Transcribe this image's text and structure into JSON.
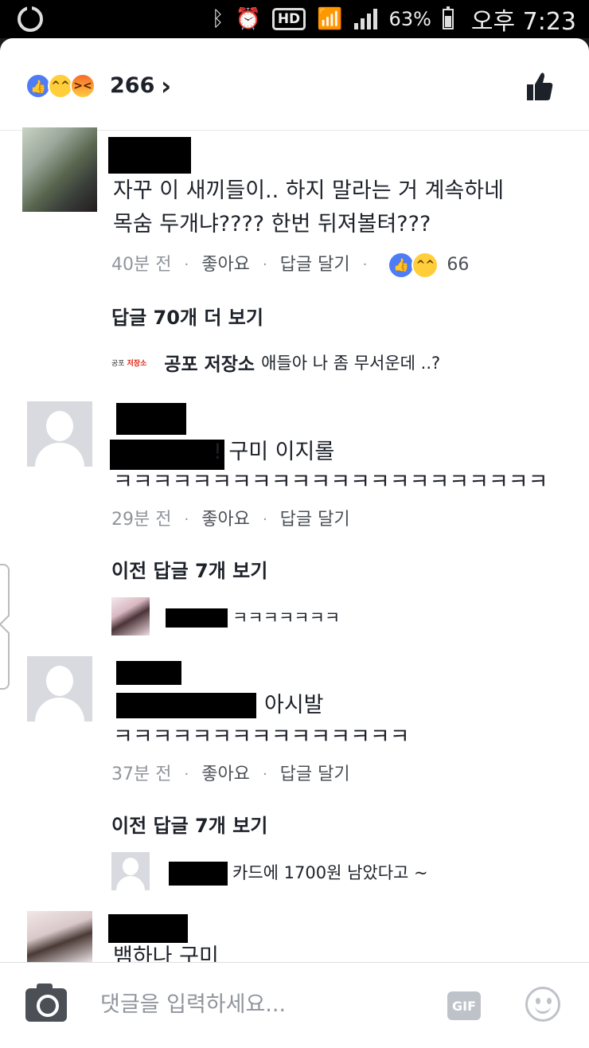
{
  "status_bar": {
    "left_icon": "carrier-logo",
    "icons": [
      "bluetooth-icon",
      "alarm-icon",
      "hd-icon",
      "wifi-icon",
      "signal-icon",
      "battery-icon"
    ],
    "hd_label": "HD",
    "battery": "63%",
    "time": "오후 7:23"
  },
  "reactions_bar": {
    "icons": [
      "like-reaction-icon",
      "haha-reaction-icon",
      "angry-reaction-icon"
    ],
    "count": "266",
    "chevron": "›",
    "action_icon": "thumbs-up-icon"
  },
  "comments": [
    {
      "avatar": "photo",
      "text_lines": [
        "자꾸 이 새끼들이.. 하지 말라는 거 계속하네",
        "목숨 두개냐???? 한번 뒤져볼텨???"
      ],
      "time": "40분 전",
      "like_label": "좋아요",
      "reply_label": "답글 달기",
      "reaction_count": "66",
      "more_replies": "답글 70개 더 보기",
      "reply": {
        "logo_prefix": "공포",
        "logo_name": "저장소",
        "name": "공포 저장소",
        "text": "애들아 나 좀 무서운데 ..?"
      }
    },
    {
      "avatar": "default-person",
      "text_lines": [
        "! 구미 이지롤",
        "ㅋㅋㅋㅋㅋㅋㅋㅋㅋㅋㅋㅋㅋㅋㅋㅋㅋㅋㅋㅋㅋㅋ"
      ],
      "time": "29분 전",
      "like_label": "좋아요",
      "reply_label": "답글 달기",
      "more_replies": "이전 답글 7개 보기",
      "reply": {
        "text": "ㅋㅋㅋㅋㅋㅋㅋ"
      }
    },
    {
      "avatar": "default-person",
      "text_lines": [
        "아시발",
        "ㅋㅋㅋㅋㅋㅋㅋㅋㅋㅋㅋㅋㅋㅋㅋ"
      ],
      "time": "37분 전",
      "like_label": "좋아요",
      "reply_label": "답글 달기",
      "more_replies": "이전 답글 7개 보기",
      "reply": {
        "text": "카드에 1700원 남았다고 ~"
      }
    },
    {
      "avatar": "photo",
      "text_lines": [
        "뱀하나 구미"
      ]
    }
  ],
  "composer": {
    "placeholder": "댓글을 입력하세요...",
    "gif_label": "GIF",
    "camera_icon": "camera-icon",
    "emoji_icon": "emoji-icon"
  },
  "separator": "·"
}
